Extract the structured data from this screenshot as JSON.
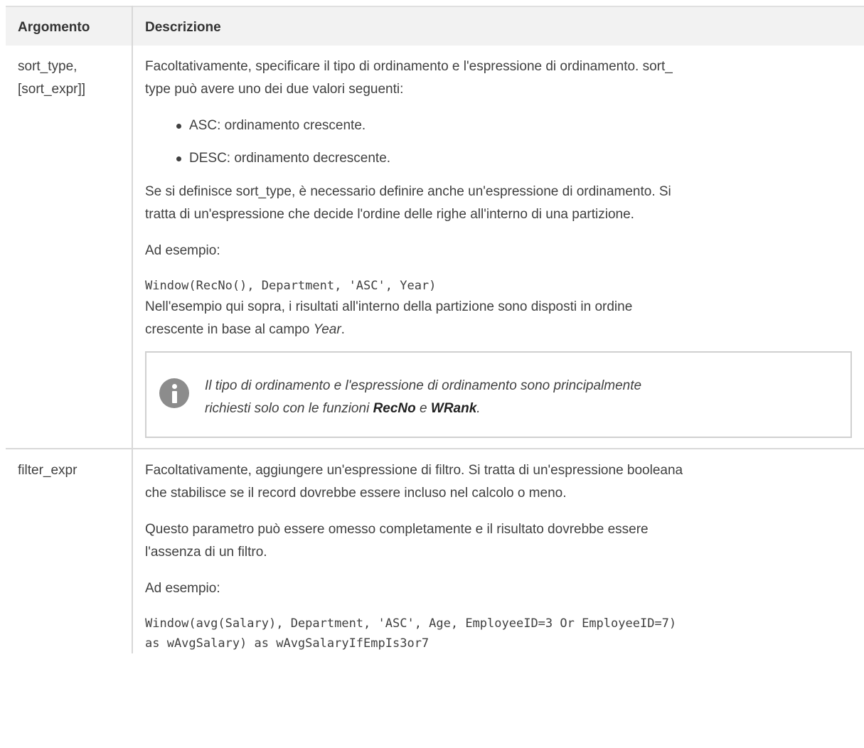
{
  "header": {
    "col1": "Argomento",
    "col2": "Descrizione"
  },
  "row1": {
    "arg_line1": "sort_type,",
    "arg_line2": "[sort_expr]]",
    "p1_line1": "Facoltativamente, specificare il tipo di ordinamento e l'espressione di ordinamento. sort_",
    "p1_line2": "type può avere uno dei due valori seguenti:",
    "bullets": [
      "ASC: ordinamento crescente.",
      "DESC: ordinamento decrescente."
    ],
    "p2_line1": "Se si definisce sort_type, è necessario definire anche un'espressione di ordinamento. Si",
    "p2_line2": "tratta di un'espressione che decide l'ordine delle righe all'interno di una partizione.",
    "example_label": "Ad esempio:",
    "code": "Window(RecNo(), Department, 'ASC', Year)",
    "p3_line1": "Nell'esempio qui sopra, i risultati all'interno della partizione sono disposti in ordine",
    "p3_line2_pre": "crescente in base al campo ",
    "p3_line2_em": "Year",
    "p3_line2_post": ".",
    "note": {
      "icon": "info-icon",
      "line1": "Il tipo di ordinamento e l'espressione di ordinamento sono principalmente",
      "line2_pre": "richiesti solo con le funzioni ",
      "bold1": "RecNo",
      "mid": " e ",
      "bold2": "WRank",
      "end": "."
    }
  },
  "row2": {
    "arg": "filter_expr",
    "p1_line1": "Facoltativamente, aggiungere un'espressione di filtro. Si tratta di un'espressione booleana",
    "p1_line2": "che stabilisce se il record dovrebbe essere incluso nel calcolo o meno.",
    "p2_line1": "Questo parametro può essere omesso completamente e il risultato dovrebbe essere",
    "p2_line2": "l'assenza di un filtro.",
    "example_label": "Ad esempio:",
    "code_line1": "Window(avg(Salary), Department, 'ASC', Age, EmployeeID=3 Or EmployeeID=7)",
    "code_line2": "as wAvgSalary) as wAvgSalaryIfEmpIs3or7"
  }
}
